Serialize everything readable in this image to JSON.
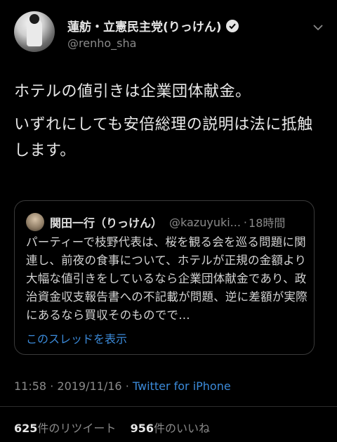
{
  "author": {
    "name": "蓮舫・立憲民主党(りっけん)",
    "handle": "@renho_sha",
    "verified": true,
    "avatar_icon": "avatar-icon",
    "menu_icon": "chevron-down-icon"
  },
  "tweet": {
    "paragraphs": [
      "ホテルの値引きは企業団体献金。",
      "いずれにしても安倍総理の説明は法に抵触します。"
    ]
  },
  "quoted": {
    "name": "関田一行（りっけん）",
    "handle": "@kazuyuki...",
    "separator": "·",
    "time": "18時間",
    "body": "パーティーで枝野代表は、桜を観る会を巡る問題に関連し、前夜の食事について、ホテルが正規の金額より大幅な値引きをしているなら企業団体献金であり、政治資金収支報告書への不記載が問題、逆に差額が実際にあるなら買収そのものでで…",
    "thread_link": "このスレッドを表示"
  },
  "meta": {
    "time": "11:58",
    "date": "2019/11/16",
    "dot": "·",
    "source": "Twitter for iPhone"
  },
  "stats": {
    "retweets_count": "625",
    "retweets_label": "件のリツイート",
    "likes_count": "956",
    "likes_label": "件のいいね"
  },
  "colors": {
    "background": "#000000",
    "link": "#3b8ad9",
    "secondary_text": "#8a8a8a"
  }
}
